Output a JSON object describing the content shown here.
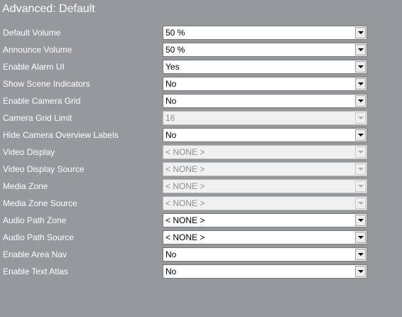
{
  "window": {
    "title": "Advanced: Default"
  },
  "settings": [
    {
      "label": "Default Volume",
      "value": "50 %",
      "enabled": true
    },
    {
      "label": "Announce Volume",
      "value": "50 %",
      "enabled": true
    },
    {
      "label": "Enable Alarm UI",
      "value": "Yes",
      "enabled": true
    },
    {
      "label": "Show Scene Indicators",
      "value": "No",
      "enabled": true
    },
    {
      "label": "Enable Camera Grid",
      "value": "No",
      "enabled": true
    },
    {
      "label": "Camera Grid Limit",
      "value": "16",
      "enabled": false
    },
    {
      "label": "Hide Camera Overview Labels",
      "value": "No",
      "enabled": true
    },
    {
      "label": "Video Display",
      "value": "< NONE >",
      "enabled": false
    },
    {
      "label": "Video Display Source",
      "value": "< NONE >",
      "enabled": false
    },
    {
      "label": "Media Zone",
      "value": "< NONE >",
      "enabled": false
    },
    {
      "label": "Media Zone Source",
      "value": "< NONE >",
      "enabled": false
    },
    {
      "label": "Audio Path Zone",
      "value": "< NONE >",
      "enabled": true
    },
    {
      "label": "Audio Path Source",
      "value": "< NONE >",
      "enabled": true
    },
    {
      "label": "Enable Area Nav",
      "value": "No",
      "enabled": true
    },
    {
      "label": "Enable Text Atlas",
      "value": "No",
      "enabled": true
    }
  ],
  "icons": {
    "dropdown": "chevron-down-icon"
  },
  "colors": {
    "background": "#96999c",
    "label_text": "#ffffff",
    "field_background": "#ffffff",
    "disabled_field_background": "#f0f0f0"
  }
}
